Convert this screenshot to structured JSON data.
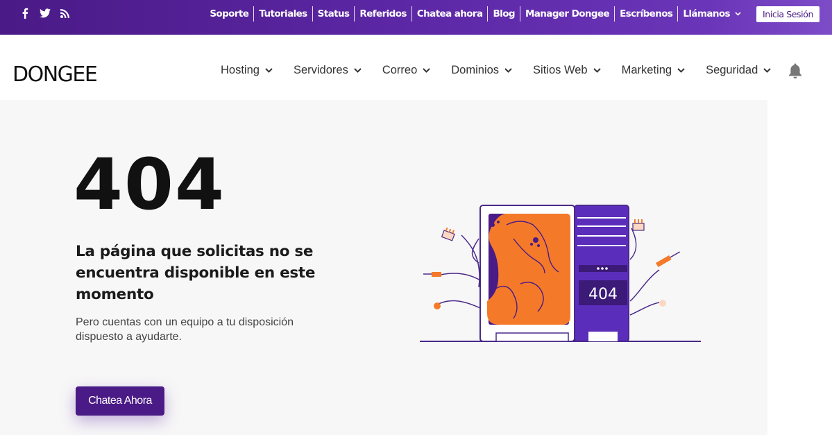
{
  "topbar": {
    "social": [
      {
        "icon": "facebook-icon",
        "glyph": "f"
      },
      {
        "icon": "twitter-icon"
      },
      {
        "icon": "rss-icon"
      }
    ],
    "links": [
      "Soporte",
      "Tutoriales",
      "Status",
      "Referidos",
      "Chatea ahora",
      "Blog",
      "Manager Dongee",
      "Escríbenos"
    ],
    "call_label": "Llámanos",
    "login_label": "Inicia Sesión"
  },
  "header": {
    "logo_text": "DONGEE",
    "nav": [
      "Hosting",
      "Servidores",
      "Correo",
      "Dominios",
      "Sitios Web",
      "Marketing",
      "Seguridad"
    ],
    "bell_icon": "bell-icon"
  },
  "main": {
    "code": "404",
    "title": "La página que solicitas no se encuentra disponible en este momento",
    "subtitle": "Pero cuentas con un equipo a tu disposición dispuesto a ayudarte.",
    "cta_label": "Chatea Ahora",
    "illustration": {
      "screen_label": "404"
    }
  },
  "colors": {
    "brand_purple": "#4a1a86",
    "accent_orange": "#f47a2a",
    "page_bg": "#f7f7f7"
  }
}
